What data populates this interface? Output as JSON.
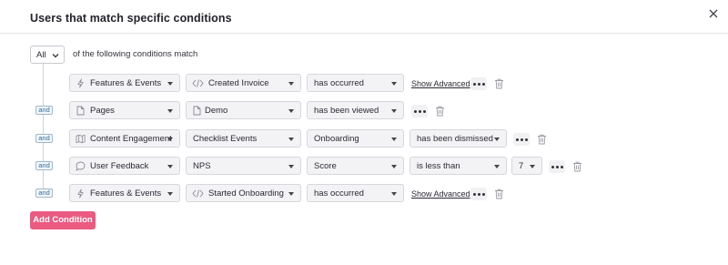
{
  "modal": {
    "title": "Users that match specific conditions"
  },
  "match": {
    "selected": "All",
    "suffix": "of the following conditions match"
  },
  "connector": "and",
  "rows": [
    {
      "f1": {
        "icon": "bolt-icon",
        "text": "Features & Events"
      },
      "f2": {
        "icon": "code-icon",
        "text": "Created Invoice"
      },
      "f3": {
        "text": "has occurred"
      },
      "advanced": "Show Advanced"
    },
    {
      "f1": {
        "icon": "page-icon",
        "text": "Pages"
      },
      "f2": {
        "icon": "page-icon",
        "text": "Demo"
      },
      "f3": {
        "text": "has been viewed"
      }
    },
    {
      "f1": {
        "icon": "map-icon",
        "text": "Content Engagement"
      },
      "f2": {
        "text": "Checklist Events"
      },
      "f3": {
        "text": "Onboarding"
      },
      "f4": {
        "text": "has been dismissed"
      }
    },
    {
      "f1": {
        "icon": "chat-bubble-icon",
        "text": "User Feedback"
      },
      "f2": {
        "text": "NPS"
      },
      "f3": {
        "text": "Score"
      },
      "f4": {
        "text": "is less than"
      },
      "f5": {
        "text": "7"
      }
    },
    {
      "f1": {
        "icon": "bolt-icon",
        "text": "Features & Events"
      },
      "f2": {
        "icon": "code-icon",
        "text": "Started Onboarding"
      },
      "f3": {
        "text": "has occurred"
      },
      "advanced": "Show Advanced"
    }
  ],
  "add_button": "Add Condition",
  "colors": {
    "accent": "#eb5a81",
    "and_badge": "#2f6d95",
    "field_bg": "#f3f3f6"
  }
}
